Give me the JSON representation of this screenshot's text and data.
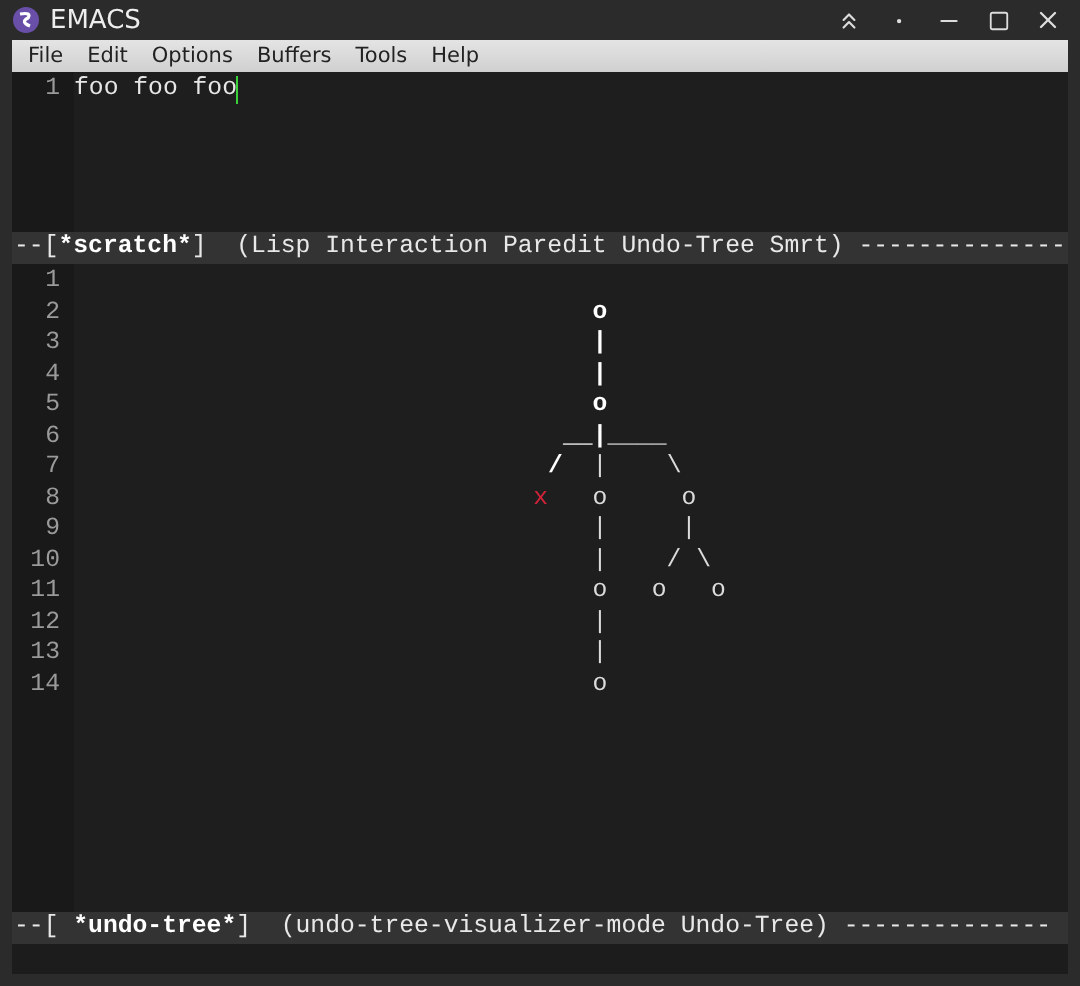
{
  "window": {
    "title": "EMACS"
  },
  "menu": [
    "File",
    "Edit",
    "Options",
    "Buffers",
    "Tools",
    "Help"
  ],
  "top_buffer": {
    "lines": [
      {
        "number": "1",
        "text": "foo foo foo"
      }
    ],
    "modeline": {
      "prefix": "--[",
      "buffer": "*scratch*",
      "suffix": "]  (Lisp Interaction Paredit Undo-Tree Smrt) --------------"
    }
  },
  "bottom_buffer": {
    "lines": [
      {
        "number": "1"
      },
      {
        "number": "2",
        "segments": [
          {
            "text": "                                   o",
            "kind": "active"
          }
        ]
      },
      {
        "number": "3",
        "segments": [
          {
            "text": "                                   |",
            "kind": "active"
          }
        ]
      },
      {
        "number": "4",
        "segments": [
          {
            "text": "                                   |",
            "kind": "active"
          }
        ]
      },
      {
        "number": "5",
        "segments": [
          {
            "text": "                                   o",
            "kind": "active"
          }
        ]
      },
      {
        "number": "6",
        "segments": [
          {
            "text": "                                 __|",
            "kind": "active"
          },
          {
            "text": "____",
            "kind": "branch"
          }
        ]
      },
      {
        "number": "7",
        "segments": [
          {
            "text": "                                /",
            "kind": "active"
          },
          {
            "text": "  |    \\",
            "kind": "branch"
          }
        ]
      },
      {
        "number": "8",
        "segments": [
          {
            "text": "                               x",
            "kind": "marker"
          },
          {
            "text": "   o     o",
            "kind": "branch"
          }
        ]
      },
      {
        "number": "9",
        "segments": [
          {
            "text": "                                   |     |",
            "kind": "branch"
          }
        ]
      },
      {
        "number": "10",
        "segments": [
          {
            "text": "                                   |    / \\",
            "kind": "branch"
          }
        ]
      },
      {
        "number": "11",
        "segments": [
          {
            "text": "                                   o   o   o",
            "kind": "branch"
          }
        ]
      },
      {
        "number": "12",
        "segments": [
          {
            "text": "                                   |",
            "kind": "branch"
          }
        ]
      },
      {
        "number": "13",
        "segments": [
          {
            "text": "                                   |",
            "kind": "branch"
          }
        ]
      },
      {
        "number": "14",
        "segments": [
          {
            "text": "                                   o",
            "kind": "branch"
          }
        ]
      }
    ],
    "modeline": {
      "prefix": "--[ ",
      "buffer": "*undo-tree*",
      "suffix": "]  (undo-tree-visualizer-mode Undo-Tree) --------------"
    }
  }
}
